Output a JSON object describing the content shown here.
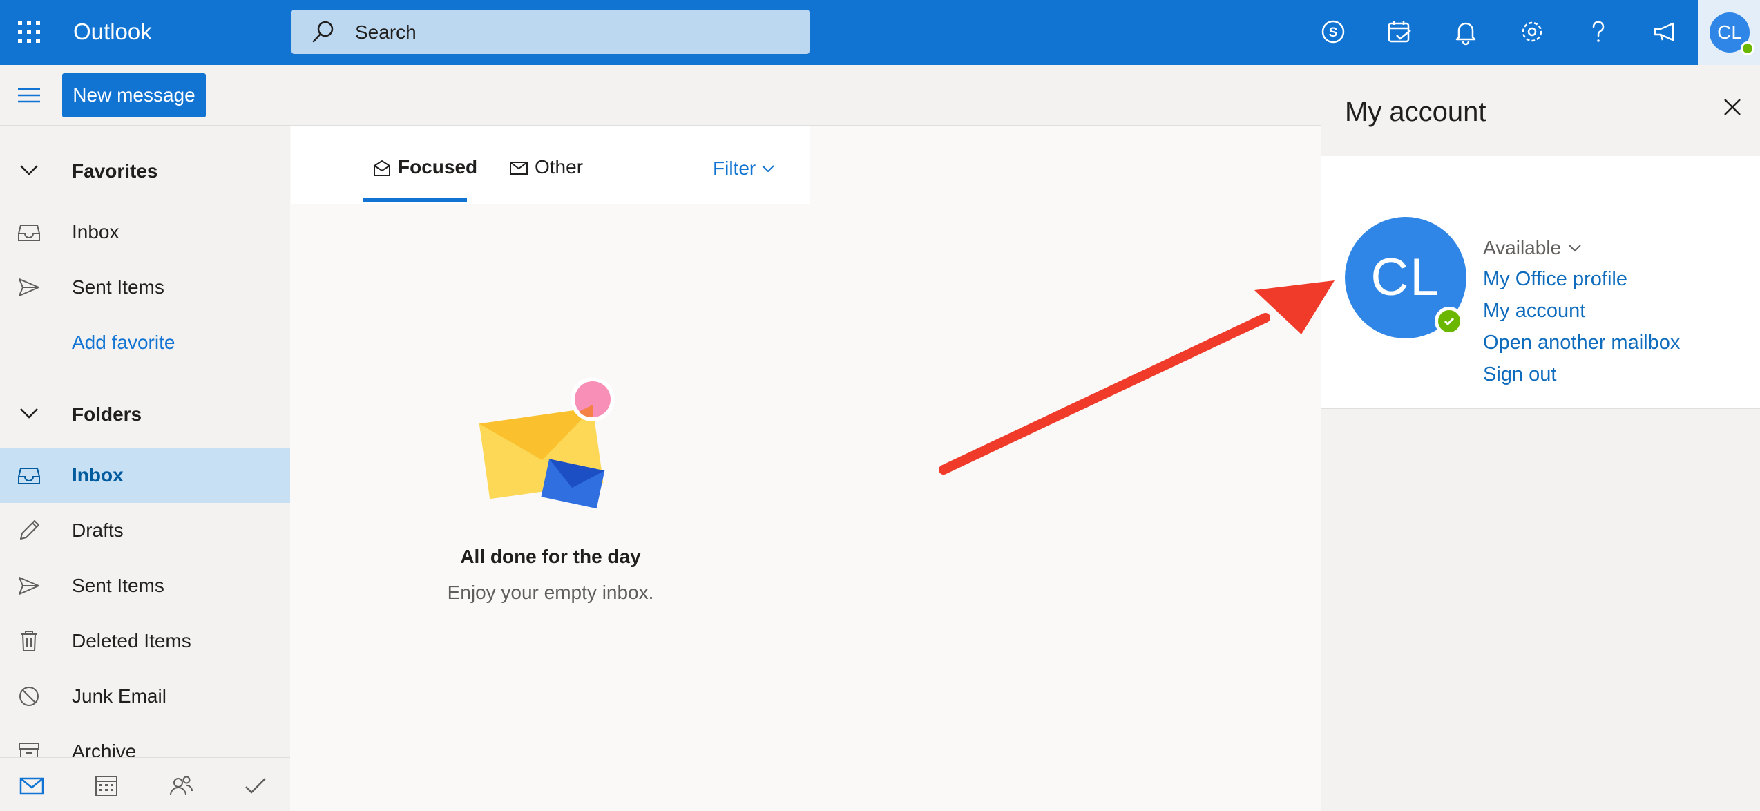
{
  "header": {
    "app_title": "Outlook",
    "search_placeholder": "Search",
    "icons": [
      "skype-icon",
      "my-day-icon",
      "notifications-icon",
      "settings-icon",
      "help-icon",
      "feedback-icon"
    ],
    "avatar_initials": "CL",
    "brand_color": "#1274d2"
  },
  "command_bar": {
    "new_message_label": "New message"
  },
  "sidebar": {
    "favorites_label": "Favorites",
    "favorites": [
      {
        "label": "Inbox",
        "icon": "inbox-icon"
      },
      {
        "label": "Sent Items",
        "icon": "sent-icon"
      }
    ],
    "add_favorite_label": "Add favorite",
    "folders_label": "Folders",
    "folders": [
      {
        "label": "Inbox",
        "icon": "inbox-icon",
        "selected": true
      },
      {
        "label": "Drafts",
        "icon": "pencil-icon"
      },
      {
        "label": "Sent Items",
        "icon": "sent-icon"
      },
      {
        "label": "Deleted Items",
        "icon": "trash-icon"
      },
      {
        "label": "Junk Email",
        "icon": "blocked-icon"
      },
      {
        "label": "Archive",
        "icon": "archive-icon"
      }
    ],
    "app_switcher": [
      "mail-icon",
      "calendar-icon",
      "people-icon",
      "todo-icon"
    ]
  },
  "message_list": {
    "tabs": [
      {
        "label": "Focused",
        "active": true
      },
      {
        "label": "Other",
        "active": false
      }
    ],
    "filter_label": "Filter",
    "empty_title": "All done for the day",
    "empty_subtitle": "Enjoy your empty inbox."
  },
  "account_panel": {
    "title": "My account",
    "initials": "CL",
    "status_label": "Available",
    "links": [
      "My Office profile",
      "My account",
      "Open another mailbox",
      "Sign out"
    ],
    "status_color": "#6bb700",
    "avatar_color": "#2f86e6"
  }
}
